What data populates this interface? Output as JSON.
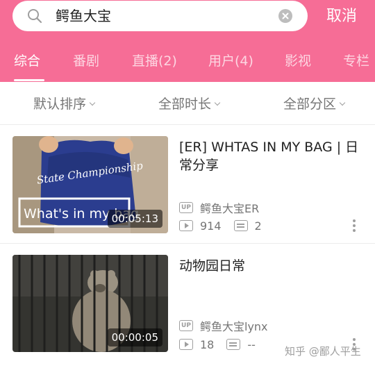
{
  "search": {
    "query": "鳄鱼大宝",
    "cancel_label": "取消"
  },
  "tabs": [
    {
      "label": "综合",
      "active": true
    },
    {
      "label": "番剧",
      "active": false
    },
    {
      "label": "直播(2)",
      "active": false
    },
    {
      "label": "用户(4)",
      "active": false
    },
    {
      "label": "影视",
      "active": false
    },
    {
      "label": "专栏",
      "active": false
    }
  ],
  "filters": [
    {
      "label": "默认排序"
    },
    {
      "label": "全部时长"
    },
    {
      "label": "全部分区"
    }
  ],
  "videos": [
    {
      "title": "[ER] WHTAS IN MY BAG | 日常分享",
      "duration": "00:05:13",
      "up_badge": "UP",
      "uploader": "鳄鱼大宝ER",
      "plays": "914",
      "danmaku": "2",
      "thumb_caption": "What's in my bag",
      "thumb_shirt_text": "State Championship"
    },
    {
      "title": "动物园日常",
      "duration": "00:00:05",
      "up_badge": "UP",
      "uploader": "鳄鱼大宝lynx",
      "plays": "18",
      "danmaku": "--"
    }
  ],
  "watermark": "知乎 @鄙人平生",
  "colors": {
    "brand_pink": "#f66d96",
    "text_secondary": "#757575"
  },
  "icons": {
    "search": "search-icon",
    "clear": "clear-icon",
    "play": "play-count-icon",
    "danmaku": "danmaku-icon",
    "more": "more-vertical-icon"
  }
}
